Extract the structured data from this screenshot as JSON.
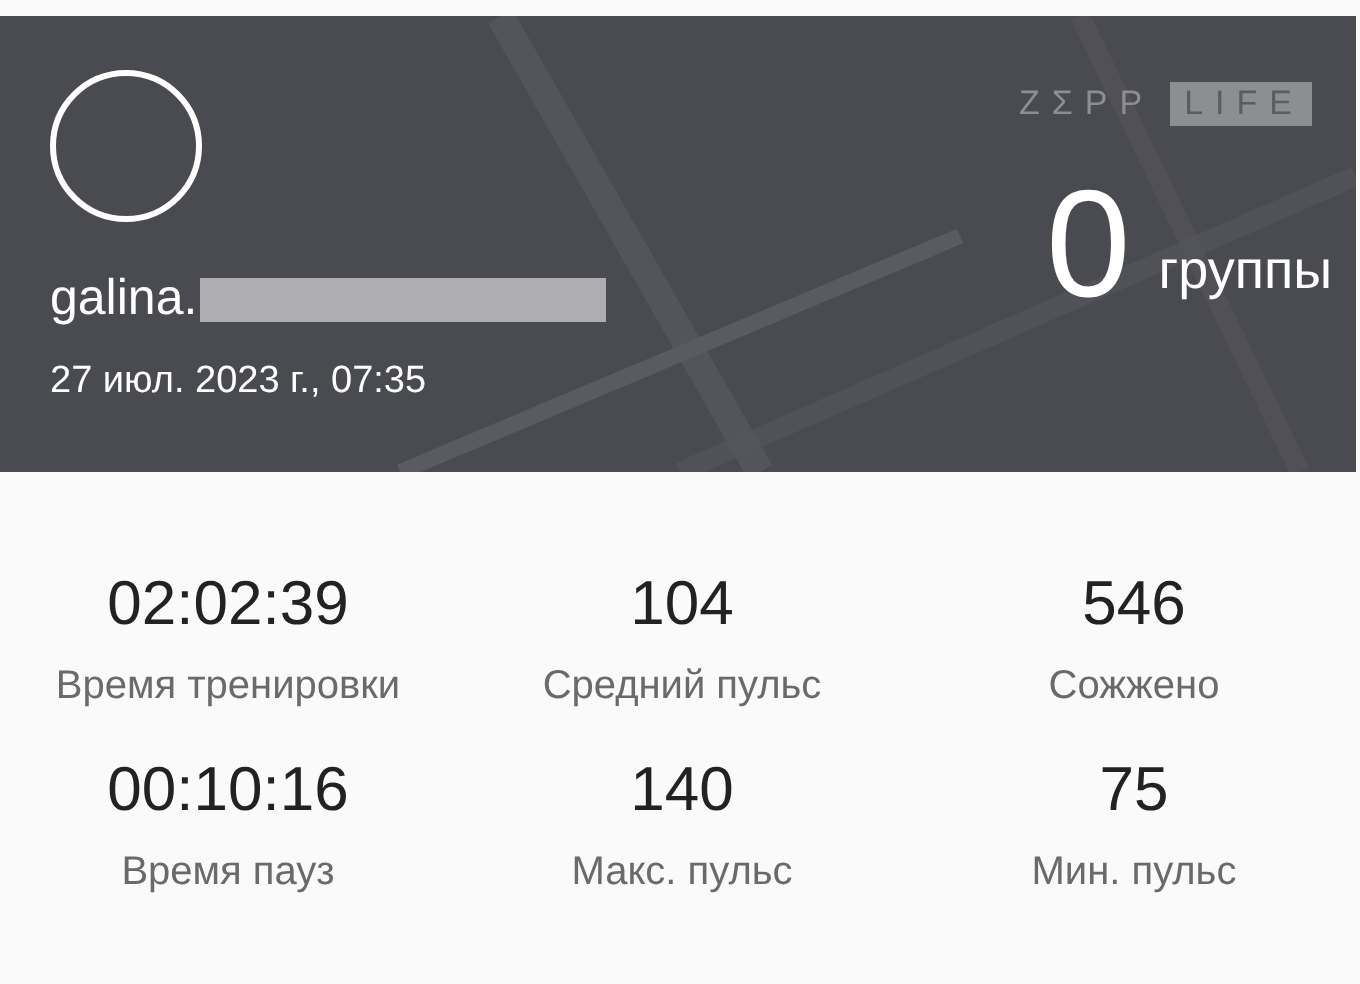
{
  "header": {
    "avatar": {
      "kind": "empty"
    },
    "logo": {
      "word_1": "ZΣPP",
      "word_2": "LIFE"
    },
    "username": "galina.",
    "username_redacted": true,
    "date": "27 июл. 2023 г., 07:35",
    "count": "0",
    "count_label": "группы"
  },
  "stats": [
    {
      "value": "02:02:39",
      "label": "Время тренировки"
    },
    {
      "value": "104",
      "label": "Средний пульс"
    },
    {
      "value": "546",
      "label": "Сожжено"
    },
    {
      "value": "00:10:16",
      "label": "Время пауз"
    },
    {
      "value": "140",
      "label": "Макс. пульс"
    },
    {
      "value": "75",
      "label": "Мин. пульс"
    }
  ]
}
